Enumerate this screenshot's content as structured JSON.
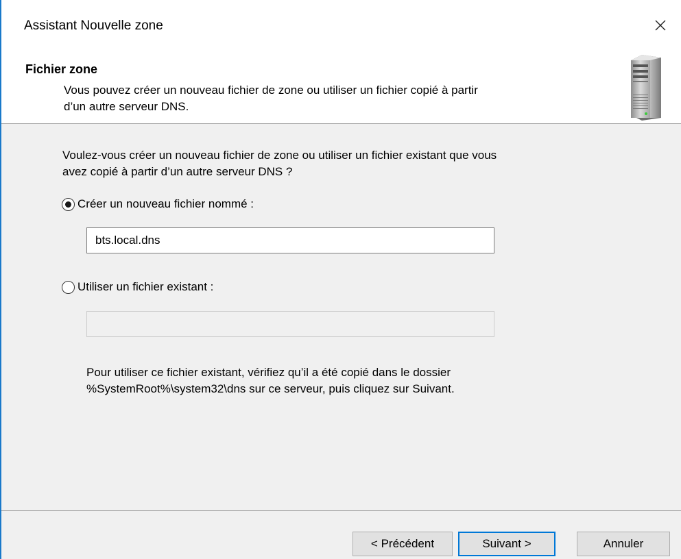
{
  "window": {
    "title": "Assistant Nouvelle zone",
    "close_icon": "close-icon",
    "accent_color": "#0078d7"
  },
  "header": {
    "title": "Fichier zone",
    "description_line1": "Vous pouvez créer un nouveau fichier de zone ou utiliser un fichier copié à partir",
    "description_line2": "d’un autre serveur DNS.",
    "icon": "server-icon"
  },
  "body": {
    "question_line1": "Voulez-vous créer un nouveau fichier de zone ou utiliser un fichier existant que vous",
    "question_line2": "avez copié à partir d’un autre serveur DNS ?",
    "options": [
      {
        "label": "Créer un nouveau fichier nommé :",
        "selected": true,
        "value": "bts.local.dns"
      },
      {
        "label": "Utiliser un fichier existant :",
        "selected": false,
        "value": ""
      }
    ],
    "info_line1": "Pour utiliser ce fichier existant, vérifiez qu’il a été copié dans le dossier",
    "info_line2": "%SystemRoot%\\system32\\dns sur ce serveur, puis cliquez sur Suivant."
  },
  "footer": {
    "back_label": "< Précédent",
    "next_label": "Suivant >",
    "cancel_label": "Annuler"
  }
}
